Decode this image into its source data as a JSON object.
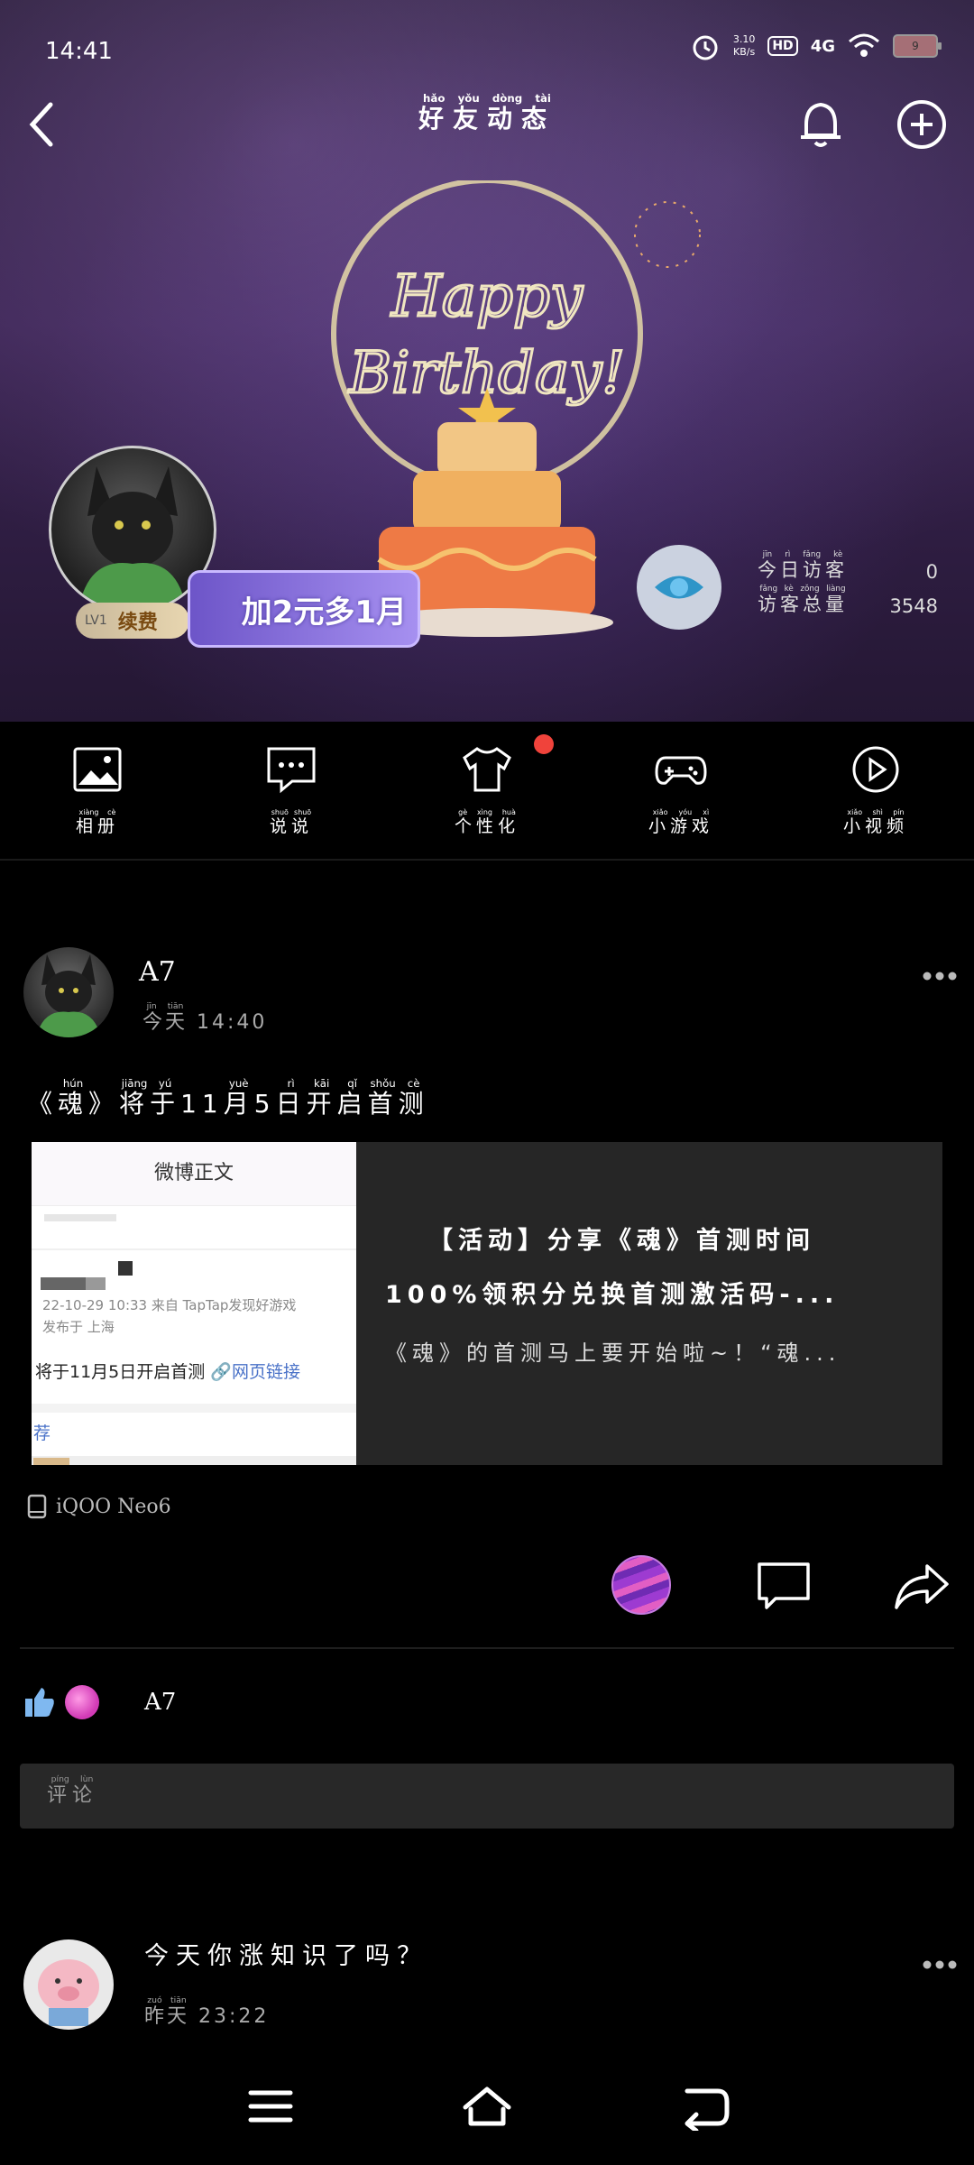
{
  "status_bar": {
    "time": "14:41",
    "net_speed_value": "3.10",
    "net_speed_unit": "KB/s",
    "hd_label": "HD",
    "network_label": "4G",
    "battery_level": "9"
  },
  "header": {
    "title": "好友动态",
    "title_pinyin": [
      "hǎo",
      "yǒu",
      "dòng",
      "tài"
    ]
  },
  "banner": {
    "art_text": "Happy Birthday!",
    "level_label": "LV1",
    "renew_label": "续费",
    "promo_label": "加2元多1月",
    "visitors": {
      "today_label": "今日访客",
      "today_pinyin": [
        "jīn",
        "rì",
        "fǎng",
        "kè"
      ],
      "today_value": "0",
      "total_label": "访客总量",
      "total_pinyin": [
        "fǎng",
        "kè",
        "zǒng",
        "liàng"
      ],
      "total_value": "3548"
    }
  },
  "shortcuts": [
    {
      "label": "相册",
      "pinyin": [
        "xiàng",
        "cè"
      ],
      "icon": "photo-album-icon"
    },
    {
      "label": "说说",
      "pinyin": [
        "shuō",
        "shuō"
      ],
      "icon": "chat-bubble-icon"
    },
    {
      "label": "个性化",
      "pinyin": [
        "gè",
        "xìng",
        "huà"
      ],
      "icon": "tshirt-icon"
    },
    {
      "label": "小游戏",
      "pinyin": [
        "xiǎo",
        "yóu",
        "xì"
      ],
      "icon": "gamepad-icon"
    },
    {
      "label": "小视频",
      "pinyin": [
        "xiǎo",
        "shì",
        "pín"
      ],
      "icon": "play-circle-icon"
    }
  ],
  "post": {
    "author": "A7",
    "time_prefix": "今天",
    "time_prefix_pinyin": [
      "jīn",
      "tiān"
    ],
    "time": "14:40",
    "text": "《魂》将于11月5日开启首测",
    "text_pinyin_map": [
      {
        "t": "《",
        "p": ""
      },
      {
        "t": "魂",
        "p": "hún"
      },
      {
        "t": "》",
        "p": ""
      },
      {
        "t": "将",
        "p": "jiāng"
      },
      {
        "t": "于",
        "p": "yú"
      },
      {
        "t": "11",
        "p": ""
      },
      {
        "t": "月",
        "p": "yuè"
      },
      {
        "t": "5",
        "p": ""
      },
      {
        "t": "日",
        "p": "rì"
      },
      {
        "t": "开",
        "p": "kāi"
      },
      {
        "t": "启",
        "p": "qǐ"
      },
      {
        "t": "首",
        "p": "shǒu"
      },
      {
        "t": "测",
        "p": "cè"
      }
    ],
    "link_card": {
      "thumb_header": "微博正文",
      "thumb_meta_line1": "22-10-29 10:33  来自 TapTap发现好游戏",
      "thumb_meta_line2": "发布于 上海",
      "thumb_main": "将于11月5日开启首测",
      "thumb_link": "🔗网页链接",
      "thumb_rec": "荐",
      "title_line1": "【活动】分享《魂》首测时间",
      "title_line2": "100%领积分兑换首测激活码-...",
      "subtitle": "《魂》的首测马上要开始啦~！“魂..."
    },
    "device": "iQOO Neo6",
    "likes_name": "A7",
    "comment_placeholder": "评论",
    "comment_placeholder_pinyin": [
      "píng",
      "lùn"
    ]
  },
  "post2": {
    "text": "今天你涨知识了吗？",
    "time_prefix": "昨天",
    "time_prefix_pinyin": [
      "zuó",
      "tiān"
    ],
    "time": "23:22"
  },
  "colors": {
    "accent_red": "#f0433b",
    "background": "#000000",
    "card_bg": "#262626"
  }
}
